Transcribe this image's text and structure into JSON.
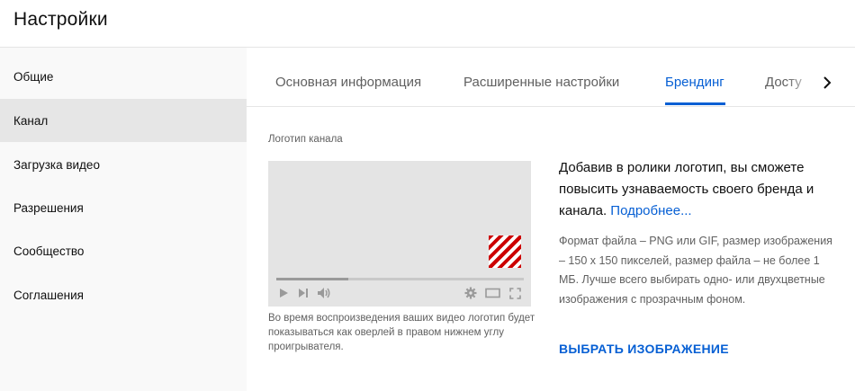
{
  "header": {
    "title": "Настройки"
  },
  "sidebar": {
    "items": [
      {
        "label": "Общие",
        "active": false
      },
      {
        "label": "Канал",
        "active": true
      },
      {
        "label": "Загрузка видео",
        "active": false
      },
      {
        "label": "Разрешения",
        "active": false
      },
      {
        "label": "Сообщество",
        "active": false
      },
      {
        "label": "Соглашения",
        "active": false
      }
    ]
  },
  "tabs": {
    "items": [
      {
        "label": "Основная информация",
        "active": false
      },
      {
        "label": "Расширенные настройки",
        "active": false
      },
      {
        "label": "Брендинг",
        "active": true
      },
      {
        "label": "Досту",
        "active": false
      }
    ],
    "next_icon": "chevron-right-icon"
  },
  "branding": {
    "section_label": "Логотип канала",
    "preview": {
      "progress_fraction": 0.29,
      "watermark_colors": [
        "#cc0000",
        "#ffffff"
      ],
      "controls": [
        "play-icon",
        "skip-next-icon",
        "volume-icon",
        "gear-icon",
        "theater-mode-icon",
        "fullscreen-icon"
      ]
    },
    "caption": "Во время воспроизведения ваших видео логотип будет показываться как оверлей в правом нижнем углу проигрывателя.",
    "description": "Добавив в ролики логотип, вы сможете повысить узнаваемость своего бренда и канала.",
    "learn_more": "Подробнее...",
    "format_info": "Формат файла – PNG или GIF, размер изображения – 150 x 150 пикселей, размер файла – не более 1 МБ. Лучше всего выбирать одно- или двухцветные изображения с прозрачным фоном.",
    "choose_button": "ВЫБРАТЬ ИЗОБРАЖЕНИЕ"
  },
  "colors": {
    "accent": "#065fd4",
    "text_primary": "#0f0f0f",
    "text_secondary": "#606060",
    "sidebar_bg": "#f9f9f9",
    "sidebar_active_bg": "#e6e6e6",
    "preview_bg": "#e4e4e4"
  }
}
